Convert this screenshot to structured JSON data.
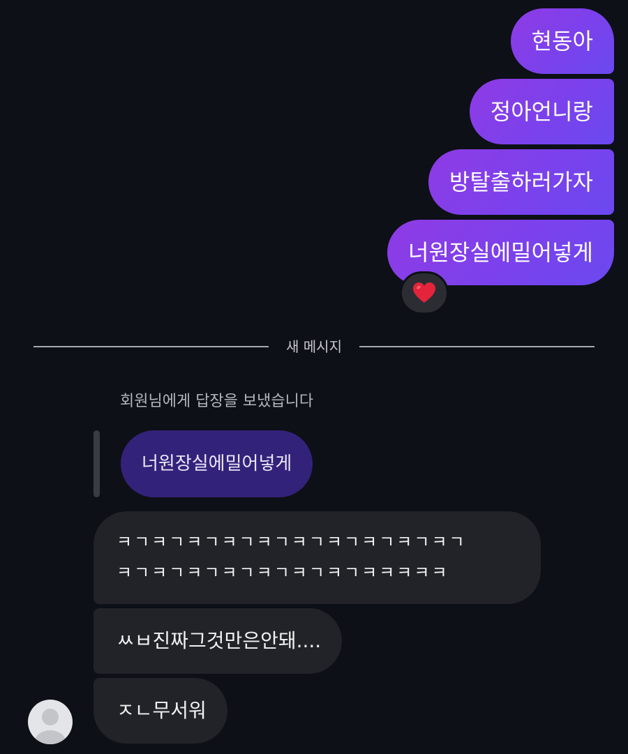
{
  "sent_messages": [
    "현동아",
    "정아언니랑",
    "방탈출하러가자",
    "너원장실에밀어넣게"
  ],
  "reaction": {
    "icon": "red-heart-icon",
    "color": "#e3243b"
  },
  "divider": {
    "label": "새 메시지"
  },
  "reply": {
    "note": "회원님에게 답장을 보냈습니다",
    "quoted_text": "너원장실에밀어넣게"
  },
  "received_messages": [
    {
      "lines": [
        "ㅋㄱㅋㄱㅋㄱㅋㄱㅋㄱㅋㄱㅋㄱㅋㄱㅋㄱㅋㄱ",
        "ㅋㄱㅋㄱㅋㄱㅋㄱㅋㄱㅋㄱㅋㄱㅋㅋㅋㅋㅋ"
      ]
    },
    {
      "text": "ㅆㅂ진짜그것만은안돼...."
    },
    {
      "text": "ㅈㄴ무서워"
    }
  ],
  "sender": {
    "avatar_icon": "default-avatar-icon"
  },
  "colors": {
    "background": "#0d1017",
    "sent_bubble_start": "#8f3be4",
    "sent_bubble_end": "#6a49f0",
    "received_bubble": "#222328",
    "quoted_bubble": "#33227a"
  }
}
